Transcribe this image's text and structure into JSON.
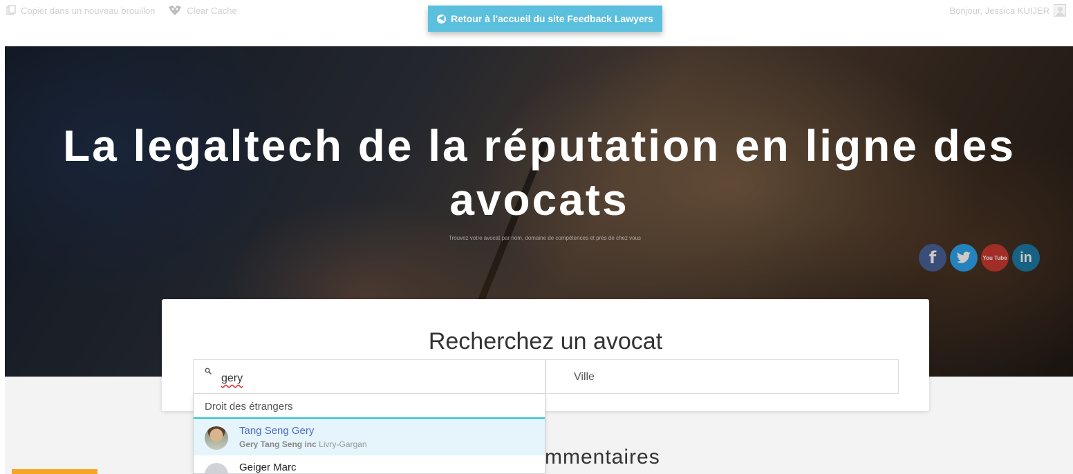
{
  "admin_bar": {
    "copy_draft": "Copier dans un nouveau brouillon",
    "clear_cache": "Clear Cache",
    "greeting": "Bonjour, Jessica KUIJER"
  },
  "back_button": {
    "label": "Retour à l'accueil du site Feedback Lawyers"
  },
  "hero": {
    "title": "La legaltech de la réputation en ligne des avocats",
    "subtitle": "Trouvez votre avocat par nom, domaine de compétences et près de chez vous"
  },
  "social": {
    "facebook": "f",
    "twitter": "twitter-bird",
    "youtube": "You Tube",
    "linkedin": "in"
  },
  "search": {
    "title": "Recherchez un avocat",
    "name_value": "gery",
    "ville_placeholder": "Ville"
  },
  "dropdown": {
    "category": "Droit des étrangers",
    "items": [
      {
        "name": "Tang Seng Gery",
        "firm": "Gery Tang Seng inc",
        "city": "Livry-Gargan"
      },
      {
        "name": "Geiger Marc"
      }
    ]
  },
  "section": {
    "comments_heading": "mmentaires"
  },
  "colors": {
    "accent": "#5bc0de",
    "highlight": "#2bc0d8",
    "link": "#4a6bc9",
    "orange": "#f5a623"
  }
}
